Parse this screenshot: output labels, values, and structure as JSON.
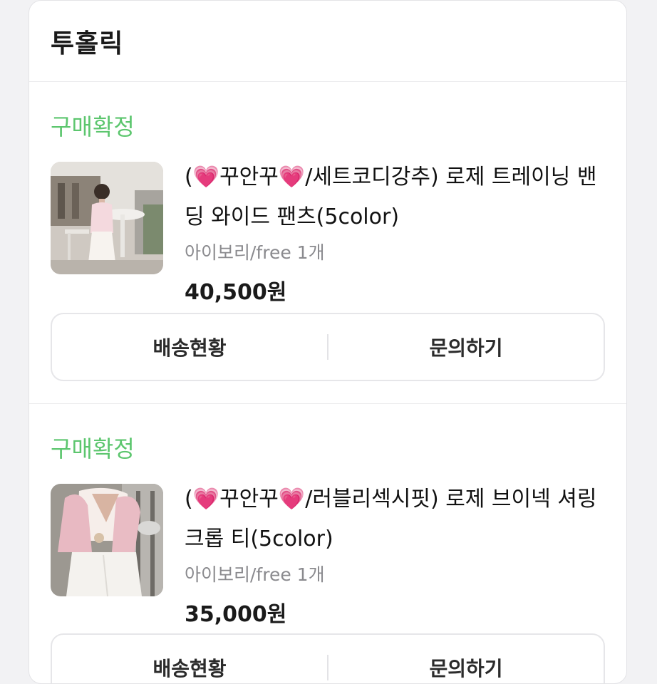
{
  "store": {
    "name": "투홀릭"
  },
  "orders": [
    {
      "status": "구매확정",
      "title_prefix": "(",
      "title_mid": "꾸안꾸",
      "title_rest": "/세트코디강추) 로제 트레이닝 밴딩 와이드 팬츠(5color)",
      "option": "아이보리/free 1개",
      "price": "40,500원",
      "actions": {
        "left": "배송현황",
        "right": "문의하기"
      }
    },
    {
      "status": "구매확정",
      "title_prefix": "(",
      "title_mid": "꾸안꾸",
      "title_rest": "/러블리섹시핏) 로제 브이넥 셔링 크롭 티(5color)",
      "option": "아이보리/free 1개",
      "price": "35,000원",
      "actions": {
        "left": "배송현황",
        "right": "문의하기"
      }
    }
  ],
  "icons": {
    "heart": "💗"
  },
  "colors": {
    "status_green": "#5cc66e",
    "heart_pink": "#e8559c"
  }
}
